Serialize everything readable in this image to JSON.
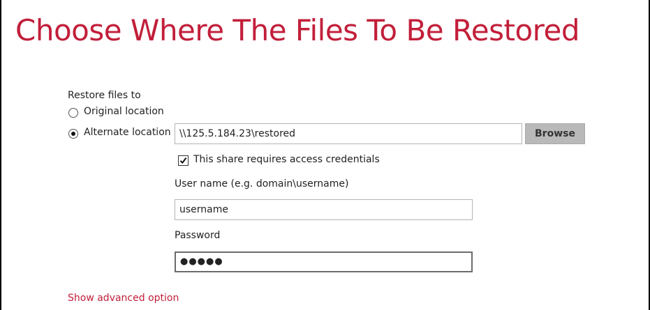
{
  "page": {
    "title": "Choose Where The Files To Be Restored"
  },
  "restore": {
    "section_label": "Restore files to",
    "options": [
      {
        "label": "Original location",
        "selected": false
      },
      {
        "label": "Alternate location",
        "selected": true
      }
    ],
    "alternate_path": "\\\\125.5.184.23\\restored",
    "browse_label": "Browse"
  },
  "credentials": {
    "checkbox_label": "This share requires access credentials",
    "checked": true,
    "username_label": "User name (e.g. domain\\username)",
    "username_value": "username",
    "password_label": "Password",
    "password_value": "●●●●●"
  },
  "advanced": {
    "link_label": "Show advanced option"
  },
  "colors": {
    "accent": "#c21f3a",
    "button_bg": "#b9b9b9"
  }
}
